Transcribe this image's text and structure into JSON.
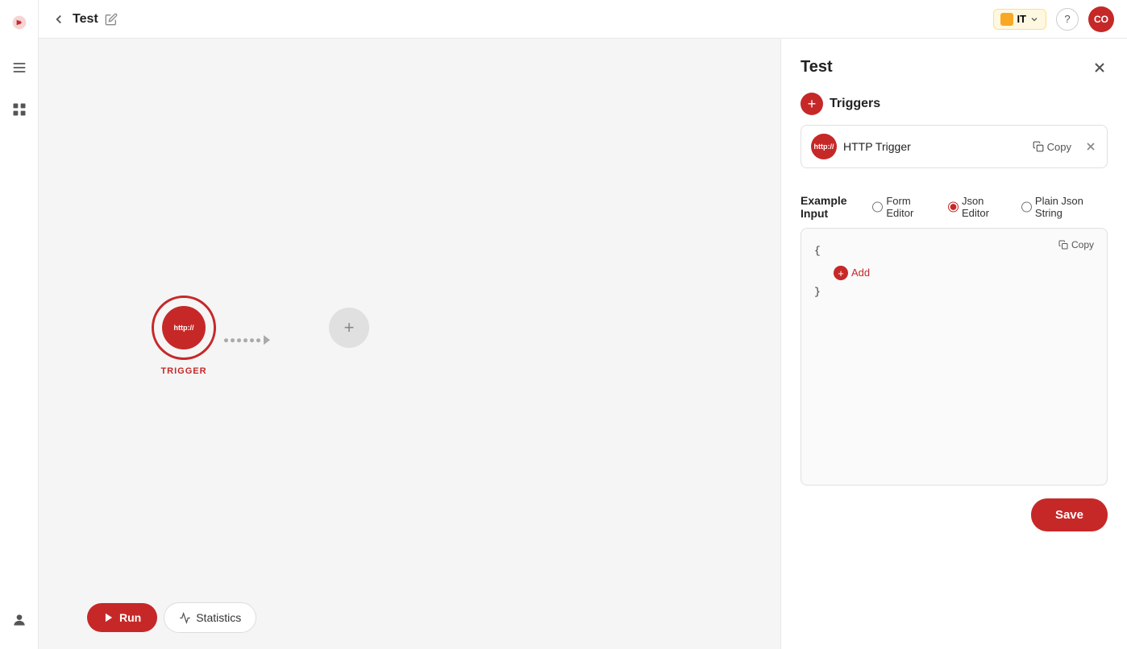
{
  "app": {
    "logo_alt": "app-logo",
    "workspace": {
      "badge": "IT",
      "dot_label": "IT"
    },
    "help_label": "?",
    "user_initials": "CO"
  },
  "topbar": {
    "back_label": "←",
    "title": "Test",
    "edit_icon": "✏"
  },
  "sidebar": {
    "items": [
      {
        "name": "menu-icon",
        "label": "≡"
      },
      {
        "name": "grid-icon",
        "label": "⊞"
      },
      {
        "name": "user-icon",
        "label": "👤"
      }
    ]
  },
  "canvas": {
    "trigger_label": "TRIGGER",
    "trigger_badge": "http://",
    "add_node_icon": "+"
  },
  "bottom_bar": {
    "run_label": "Run",
    "statistics_label": "Statistics",
    "stats_icon": "📈"
  },
  "panel": {
    "title": "Test",
    "close_icon": "✕",
    "triggers_label": "Triggers",
    "add_trigger_icon": "+",
    "trigger_item": {
      "badge": "http://",
      "name": "HTTP Trigger",
      "copy_label": "Copy",
      "delete_icon": "✕"
    },
    "example_input": {
      "label": "Example Input",
      "options": [
        {
          "id": "form-editor",
          "label": "Form Editor",
          "checked": false
        },
        {
          "id": "json-editor",
          "label": "Json Editor",
          "checked": true
        },
        {
          "id": "plain-json",
          "label": "Plain Json String",
          "checked": false
        }
      ],
      "copy_label": "Copy",
      "json_open": "{",
      "json_close": "}",
      "add_label": "Add"
    },
    "save_label": "Save"
  }
}
